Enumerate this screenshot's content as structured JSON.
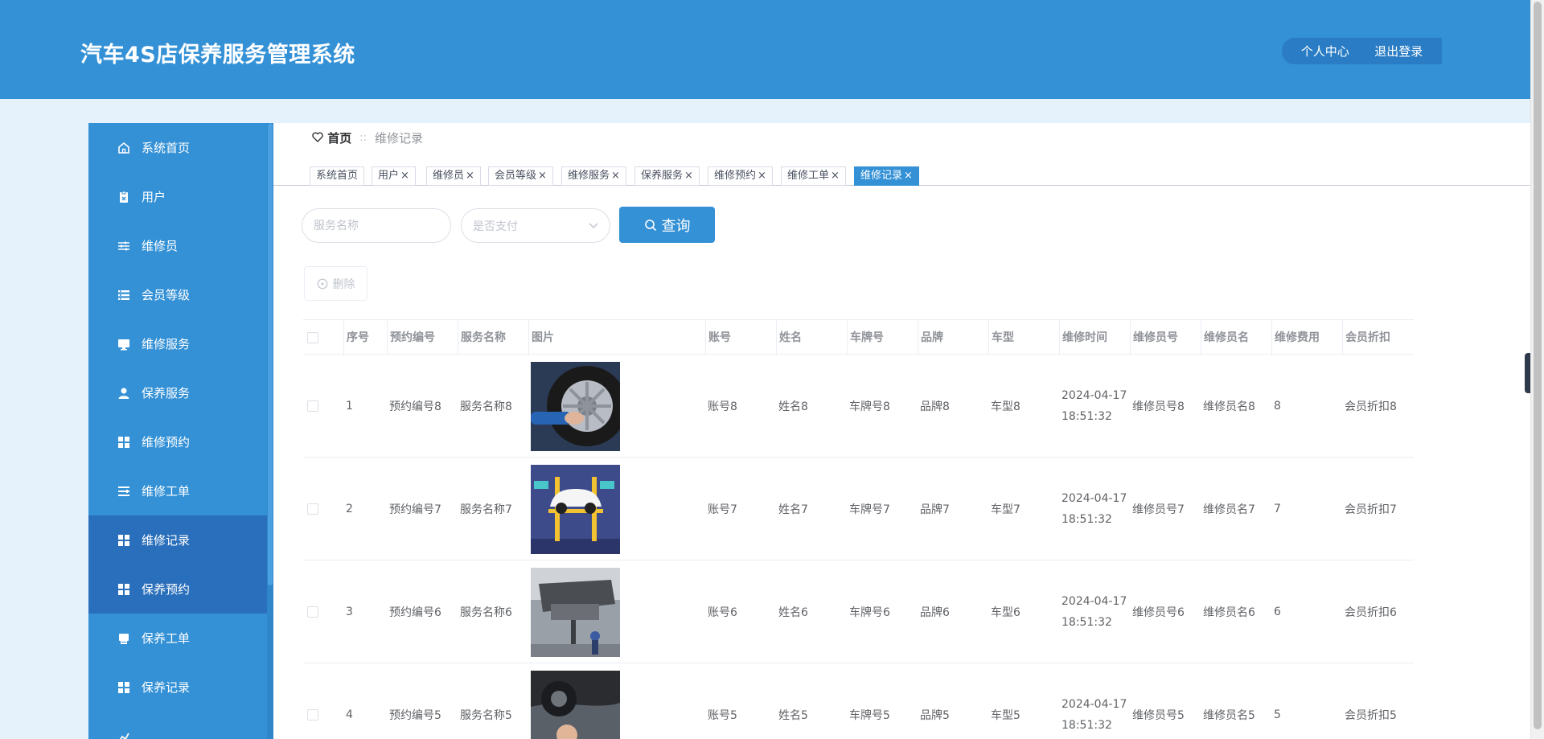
{
  "header": {
    "title": "汽车4S店保养服务管理系统",
    "profile_label": "个人中心",
    "logout_label": "退出登录"
  },
  "sidebar": {
    "items": [
      {
        "label": "系统首页",
        "icon": "home-icon"
      },
      {
        "label": "用户",
        "icon": "clipboard-icon"
      },
      {
        "label": "维修员",
        "icon": "sliders-icon"
      },
      {
        "label": "会员等级",
        "icon": "list-icon"
      },
      {
        "label": "维修服务",
        "icon": "monitor-icon"
      },
      {
        "label": "保养服务",
        "icon": "user-icon"
      },
      {
        "label": "维修预约",
        "icon": "grid-icon"
      },
      {
        "label": "维修工单",
        "icon": "list-icon"
      },
      {
        "label": "维修记录",
        "icon": "grid-icon"
      },
      {
        "label": "保养预约",
        "icon": "grid-icon"
      },
      {
        "label": "保养工单",
        "icon": "printer-icon"
      },
      {
        "label": "保养记录",
        "icon": "grid-icon"
      }
    ]
  },
  "breadcrumb": {
    "home": "首页",
    "separator": "::",
    "current": "维修记录"
  },
  "tabs": [
    "系统首页",
    "用户",
    "维修员",
    "会员等级",
    "维修服务",
    "保养服务",
    "维修预约",
    "维修工单",
    "维修记录"
  ],
  "tab_close": "×",
  "search": {
    "name_placeholder": "服务名称",
    "paid_placeholder": "是否支付",
    "query_label": "查询"
  },
  "toolbar": {
    "delete_label": "删除"
  },
  "table": {
    "columns": [
      "序号",
      "预约编号",
      "服务名称",
      "图片",
      "账号",
      "姓名",
      "车牌号",
      "品牌",
      "车型",
      "维修时间",
      "维修员号",
      "维修员名",
      "维修费用",
      "会员折扣"
    ],
    "rows": [
      {
        "index": "1",
        "booking_no": "预约编号8",
        "service": "服务名称8",
        "image": "tire-service",
        "account": "账号8",
        "name": "姓名8",
        "plate": "车牌号8",
        "brand": "品牌8",
        "model": "车型8",
        "date": "2024-04-17",
        "time": "18:51:32",
        "tech_no": "维修员号8",
        "tech_name": "维修员名8",
        "fee": "8",
        "discount": "会员折扣8"
      },
      {
        "index": "2",
        "booking_no": "预约编号7",
        "service": "服务名称7",
        "image": "car-lift-illustration",
        "account": "账号7",
        "name": "姓名7",
        "plate": "车牌号7",
        "brand": "品牌7",
        "model": "车型7",
        "date": "2024-04-17",
        "time": "18:51:32",
        "tech_no": "维修员号7",
        "tech_name": "维修员名7",
        "fee": "7",
        "discount": "会员折扣7"
      },
      {
        "index": "3",
        "booking_no": "预约编号6",
        "service": "服务名称6",
        "image": "undercarriage-lift",
        "account": "账号6",
        "name": "姓名6",
        "plate": "车牌号6",
        "brand": "品牌6",
        "model": "车型6",
        "date": "2024-04-17",
        "time": "18:51:32",
        "tech_no": "维修员号6",
        "tech_name": "维修员名6",
        "fee": "6",
        "discount": "会员折扣6"
      },
      {
        "index": "4",
        "booking_no": "预约编号5",
        "service": "服务名称5",
        "image": "mechanic-under-car",
        "account": "账号5",
        "name": "姓名5",
        "plate": "车牌号5",
        "brand": "品牌5",
        "model": "车型5",
        "date": "2024-04-17",
        "time": "18:51:32",
        "tech_no": "维修员号5",
        "tech_name": "维修员名5",
        "fee": "5",
        "discount": "会员折扣5"
      }
    ]
  },
  "colors": {
    "primary": "#3491d6",
    "sidebar_active": "#2a6fbb",
    "page_bg": "#e6f2fb"
  }
}
